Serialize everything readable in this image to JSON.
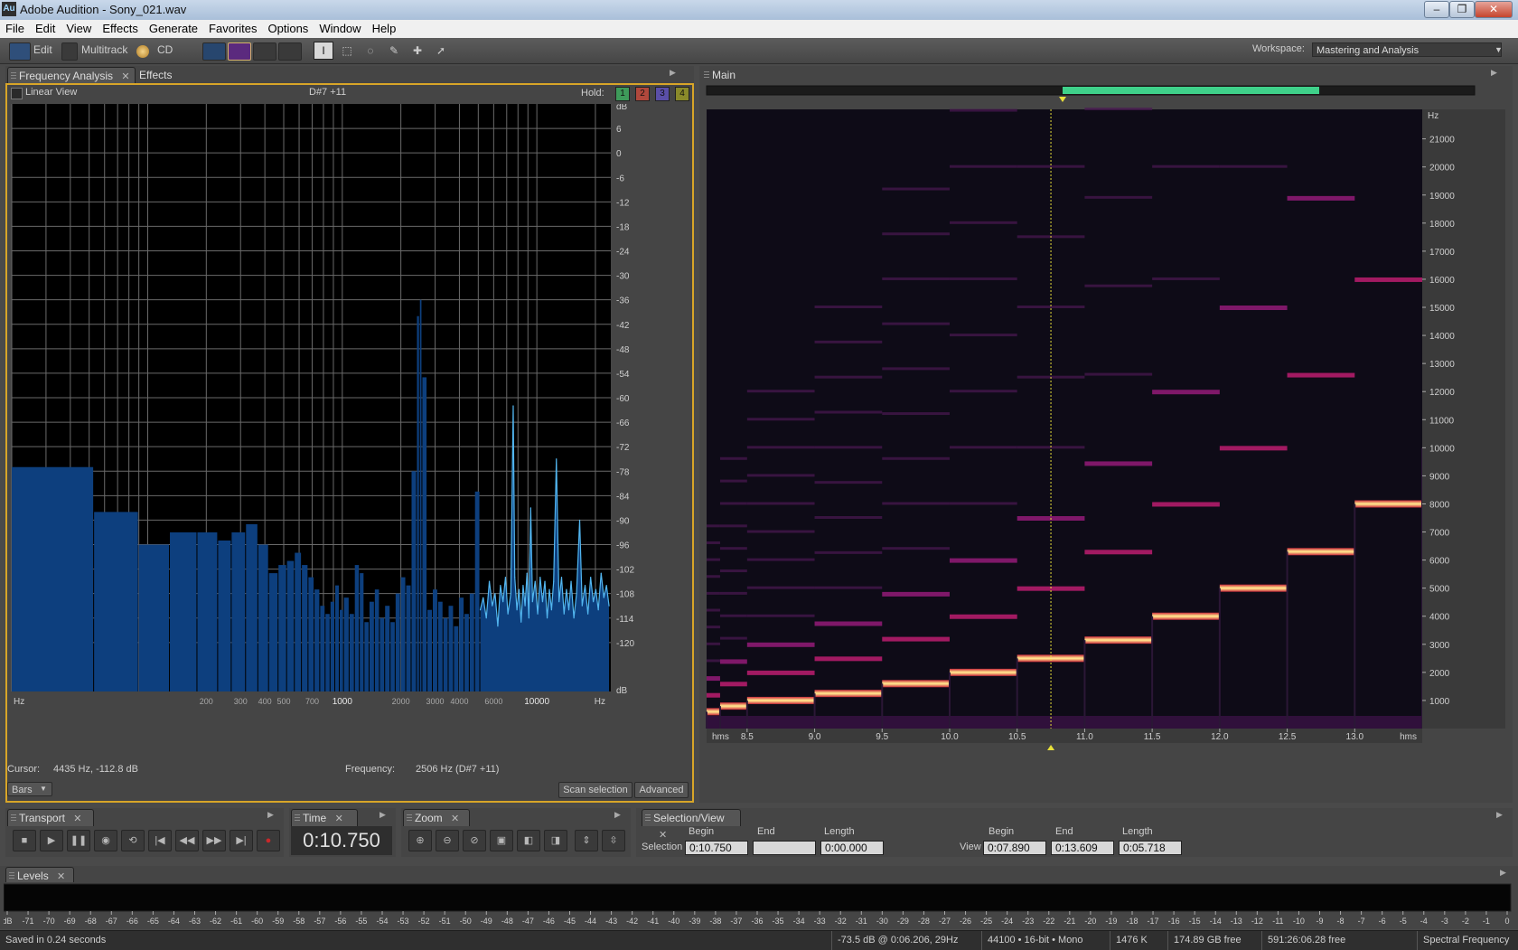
{
  "window": {
    "icon": "Au",
    "title": "Adobe Audition - Sony_021.wav",
    "minimize": "–",
    "restore": "❐",
    "close": "✕"
  },
  "menu": [
    "File",
    "Edit",
    "View",
    "Effects",
    "Generate",
    "Favorites",
    "Options",
    "Window",
    "Help"
  ],
  "toolbar": {
    "edit": "Edit",
    "multitrack": "Multitrack",
    "cd": "CD",
    "workspace_label": "Workspace:",
    "workspace_value": "Mastering and Analysis"
  },
  "freq_panel": {
    "tab_active": "Frequency Analysis",
    "tab_other": "Effects",
    "linear_view": "Linear View",
    "note": "D#7 +11",
    "hold_label": "Hold:",
    "holds": [
      "1",
      "2",
      "3",
      "4"
    ],
    "hold_colors": [
      "#3e9a5a",
      "#b0483c",
      "#5a4fa8",
      "#8a8a2a"
    ],
    "cursor_label": "Cursor:",
    "cursor_value": "4435 Hz, -112.8 dB",
    "frequency_label": "Frequency:",
    "frequency_value": "2506 Hz (D#7 +11)",
    "mode": "Bars",
    "scan_button": "Scan selection",
    "advanced_button": "Advanced"
  },
  "chart_data": [
    {
      "type": "bar",
      "title": "",
      "xlabel": "Hz",
      "ylabel": "dB",
      "x_scale": "log",
      "xlim": [
        20,
        24000
      ],
      "ylim": [
        -132,
        12
      ],
      "x_ticks": [
        {
          "value": 200,
          "label": "200"
        },
        {
          "value": 300,
          "label": "300"
        },
        {
          "value": 400,
          "label": "400"
        },
        {
          "value": 500,
          "label": "500"
        },
        {
          "value": 700,
          "label": "700"
        },
        {
          "value": 1000,
          "label": "1000"
        },
        {
          "value": 2000,
          "label": "2000"
        },
        {
          "value": 3000,
          "label": "3000"
        },
        {
          "value": 4000,
          "label": "4000"
        },
        {
          "value": 6000,
          "label": "6000"
        },
        {
          "value": 10000,
          "label": "10000"
        }
      ],
      "y_ticks": [
        "6",
        "0",
        "-6",
        "-12",
        "-18",
        "-24",
        "-30",
        "-36",
        "-42",
        "-48",
        "-54",
        "-60",
        "-66",
        "-72",
        "-78",
        "-84",
        "-90",
        "-96",
        "-102",
        "-108",
        "-114",
        "-120"
      ],
      "y_unit_top": "dB",
      "y_unit_bottom": "dB",
      "x_unit_left": "Hz",
      "x_unit_right": "Hz",
      "bars": [
        {
          "f0": 20,
          "f1": 53,
          "db": -77
        },
        {
          "f0": 53,
          "f1": 90,
          "db": -88
        },
        {
          "f0": 90,
          "f1": 130,
          "db": -96
        },
        {
          "f0": 130,
          "f1": 180,
          "db": -93
        },
        {
          "f0": 180,
          "f1": 230,
          "db": -93
        },
        {
          "f0": 230,
          "f1": 270,
          "db": -95
        },
        {
          "f0": 270,
          "f1": 320,
          "db": -93
        },
        {
          "f0": 320,
          "f1": 370,
          "db": -91
        },
        {
          "f0": 370,
          "f1": 420,
          "db": -96
        },
        {
          "f0": 420,
          "f1": 470,
          "db": -103
        },
        {
          "f0": 470,
          "f1": 520,
          "db": -101
        },
        {
          "f0": 520,
          "f1": 570,
          "db": -100
        },
        {
          "f0": 570,
          "f1": 620,
          "db": -98
        },
        {
          "f0": 620,
          "f1": 670,
          "db": -101
        },
        {
          "f0": 670,
          "f1": 720,
          "db": -104
        },
        {
          "f0": 720,
          "f1": 770,
          "db": -107
        },
        {
          "f0": 770,
          "f1": 820,
          "db": -111
        },
        {
          "f0": 820,
          "f1": 870,
          "db": -113
        },
        {
          "f0": 870,
          "f1": 920,
          "db": -110
        },
        {
          "f0": 920,
          "f1": 970,
          "db": -106
        },
        {
          "f0": 970,
          "f1": 1020,
          "db": -112
        },
        {
          "f0": 1020,
          "f1": 1090,
          "db": -109
        },
        {
          "f0": 1090,
          "f1": 1160,
          "db": -113
        },
        {
          "f0": 1160,
          "f1": 1230,
          "db": -101
        },
        {
          "f0": 1230,
          "f1": 1300,
          "db": -103
        },
        {
          "f0": 1300,
          "f1": 1380,
          "db": -115
        },
        {
          "f0": 1380,
          "f1": 1470,
          "db": -110
        },
        {
          "f0": 1470,
          "f1": 1560,
          "db": -107
        },
        {
          "f0": 1560,
          "f1": 1660,
          "db": -114
        },
        {
          "f0": 1660,
          "f1": 1770,
          "db": -111
        },
        {
          "f0": 1770,
          "f1": 1880,
          "db": -115
        },
        {
          "f0": 1880,
          "f1": 2000,
          "db": -108
        },
        {
          "f0": 2000,
          "f1": 2130,
          "db": -104
        },
        {
          "f0": 2130,
          "f1": 2270,
          "db": -106
        },
        {
          "f0": 2270,
          "f1": 2420,
          "db": -78
        },
        {
          "f0": 2420,
          "f1": 2506,
          "db": -40
        },
        {
          "f0": 2506,
          "f1": 2580,
          "db": -36
        },
        {
          "f0": 2580,
          "f1": 2740,
          "db": -55
        },
        {
          "f0": 2740,
          "f1": 2920,
          "db": -112
        },
        {
          "f0": 2920,
          "f1": 3110,
          "db": -107
        },
        {
          "f0": 3110,
          "f1": 3310,
          "db": -110
        },
        {
          "f0": 3310,
          "f1": 3520,
          "db": -114
        },
        {
          "f0": 3520,
          "f1": 3750,
          "db": -111
        },
        {
          "f0": 3750,
          "f1": 3990,
          "db": -116
        },
        {
          "f0": 3990,
          "f1": 4250,
          "db": -109
        },
        {
          "f0": 4250,
          "f1": 4520,
          "db": -113
        },
        {
          "f0": 4520,
          "f1": 4810,
          "db": -108
        },
        {
          "f0": 4810,
          "f1": 5120,
          "db": -83
        }
      ],
      "line_points": [
        {
          "f": 5120,
          "db": -112
        },
        {
          "f": 5300,
          "db": -109
        },
        {
          "f": 5500,
          "db": -114
        },
        {
          "f": 5700,
          "db": -105
        },
        {
          "f": 5900,
          "db": -111
        },
        {
          "f": 6100,
          "db": -108
        },
        {
          "f": 6300,
          "db": -116
        },
        {
          "f": 6500,
          "db": -106
        },
        {
          "f": 6700,
          "db": -110
        },
        {
          "f": 6900,
          "db": -104
        },
        {
          "f": 7100,
          "db": -113
        },
        {
          "f": 7350,
          "db": -108
        },
        {
          "f": 7560,
          "db": -62
        },
        {
          "f": 7700,
          "db": -104
        },
        {
          "f": 7900,
          "db": -112
        },
        {
          "f": 8100,
          "db": -107
        },
        {
          "f": 8300,
          "db": -115
        },
        {
          "f": 8500,
          "db": -106
        },
        {
          "f": 8700,
          "db": -111
        },
        {
          "f": 8900,
          "db": -103
        },
        {
          "f": 9100,
          "db": -114
        },
        {
          "f": 9300,
          "db": -87
        },
        {
          "f": 9500,
          "db": -110
        },
        {
          "f": 9800,
          "db": -105
        },
        {
          "f": 10100,
          "db": -113
        },
        {
          "f": 10400,
          "db": -104
        },
        {
          "f": 10700,
          "db": -110
        },
        {
          "f": 11000,
          "db": -105
        },
        {
          "f": 11300,
          "db": -114
        },
        {
          "f": 11600,
          "db": -107
        },
        {
          "f": 11900,
          "db": -112
        },
        {
          "f": 12200,
          "db": -105
        },
        {
          "f": 12600,
          "db": -75
        },
        {
          "f": 13000,
          "db": -110
        },
        {
          "f": 13400,
          "db": -104
        },
        {
          "f": 13800,
          "db": -113
        },
        {
          "f": 14200,
          "db": -107
        },
        {
          "f": 14600,
          "db": -112
        },
        {
          "f": 15000,
          "db": -105
        },
        {
          "f": 15500,
          "db": -114
        },
        {
          "f": 16000,
          "db": -108
        },
        {
          "f": 16600,
          "db": -90
        },
        {
          "f": 17100,
          "db": -111
        },
        {
          "f": 17700,
          "db": -106
        },
        {
          "f": 18300,
          "db": -113
        },
        {
          "f": 18900,
          "db": -104
        },
        {
          "f": 19500,
          "db": -110
        },
        {
          "f": 20100,
          "db": -107
        },
        {
          "f": 20700,
          "db": -112
        },
        {
          "f": 21400,
          "db": -103
        },
        {
          "f": 22100,
          "db": -109
        },
        {
          "f": 22800,
          "db": -106
        },
        {
          "f": 23500,
          "db": -111
        }
      ]
    },
    {
      "type": "heatmap",
      "title": "Main",
      "xlabel": "hms",
      "ylabel": "Hz",
      "xlim": [
        8.2,
        13.5
      ],
      "ylim": [
        0,
        22050
      ],
      "x_ticks": [
        "8.5",
        "9.0",
        "9.5",
        "10.0",
        "10.5",
        "11.0",
        "11.5",
        "12.0",
        "12.5",
        "13.0"
      ],
      "x_tick_values": [
        8.5,
        9.0,
        9.5,
        10.0,
        10.5,
        11.0,
        11.5,
        12.0,
        12.5,
        13.0
      ],
      "x_unit_left": "hms",
      "x_unit_right": "hms",
      "y_ticks": [
        "21000",
        "20000",
        "19000",
        "18000",
        "17000",
        "16000",
        "15000",
        "14000",
        "13000",
        "12000",
        "11000",
        "10000",
        "9000",
        "8000",
        "7000",
        "6000",
        "5000",
        "4000",
        "3000",
        "2000",
        "1000"
      ],
      "y_tick_values": [
        21000,
        20000,
        19000,
        18000,
        17000,
        16000,
        15000,
        14000,
        13000,
        12000,
        11000,
        10000,
        9000,
        8000,
        7000,
        6000,
        5000,
        4000,
        3000,
        2000,
        1000
      ],
      "y_unit_top": "Hz",
      "cursor_time": 10.75,
      "tones": [
        {
          "t0": 8.2,
          "t1": 8.3,
          "f": 600
        },
        {
          "t0": 8.3,
          "t1": 8.5,
          "f": 800
        },
        {
          "t0": 8.5,
          "t1": 9.0,
          "f": 1000
        },
        {
          "t0": 9.0,
          "t1": 9.5,
          "f": 1250
        },
        {
          "t0": 9.5,
          "t1": 10.0,
          "f": 1600
        },
        {
          "t0": 10.0,
          "t1": 10.5,
          "f": 2000
        },
        {
          "t0": 10.5,
          "t1": 11.0,
          "f": 2500
        },
        {
          "t0": 11.0,
          "t1": 11.5,
          "f": 3150
        },
        {
          "t0": 11.5,
          "t1": 12.0,
          "f": 4000
        },
        {
          "t0": 12.0,
          "t1": 12.5,
          "f": 5000
        },
        {
          "t0": 12.5,
          "t1": 13.0,
          "f": 6300
        },
        {
          "t0": 13.0,
          "t1": 13.5,
          "f": 8000
        },
        {
          "t0": 13.5,
          "t1": 13.6,
          "f": 10000
        }
      ]
    },
    {
      "type": "bar",
      "title": "Levels",
      "xlabel": "dB",
      "x_ticks": [
        "dB",
        "-71",
        "-70",
        "-69",
        "-68",
        "-67",
        "-66",
        "-65",
        "-64",
        "-63",
        "-62",
        "-61",
        "-60",
        "-59",
        "-58",
        "-57",
        "-56",
        "-55",
        "-54",
        "-53",
        "-52",
        "-51",
        "-50",
        "-49",
        "-48",
        "-47",
        "-46",
        "-45",
        "-44",
        "-43",
        "-42",
        "-41",
        "-40",
        "-39",
        "-38",
        "-37",
        "-36",
        "-35",
        "-34",
        "-33",
        "-32",
        "-31",
        "-30",
        "-29",
        "-28",
        "-27",
        "-26",
        "-25",
        "-24",
        "-23",
        "-22",
        "-21",
        "-20",
        "-19",
        "-18",
        "-17",
        "-16",
        "-15",
        "-14",
        "-13",
        "-12",
        "-11",
        "-10",
        "-9",
        "-8",
        "-7",
        "-6",
        "-5",
        "-4",
        "-3",
        "-2",
        "-1",
        "0"
      ]
    }
  ],
  "main_panel": {
    "tab": "Main"
  },
  "transport": {
    "tab": "Transport"
  },
  "time": {
    "tab": "Time",
    "value": "0:10.750"
  },
  "zoom": {
    "tab": "Zoom"
  },
  "selection_view": {
    "tab": "Selection/View",
    "begin": "Begin",
    "end": "End",
    "length": "Length",
    "selection_label": "Selection",
    "view_label": "View",
    "sel_begin": "0:10.750",
    "sel_end": "",
    "sel_length": "0:00.000",
    "view_begin": "0:07.890",
    "view_end": "0:13.609",
    "view_length": "0:05.718"
  },
  "levels": {
    "tab": "Levels"
  },
  "status": {
    "message": "Saved in 0.24 seconds",
    "cursor": "-73.5 dB @  0:06.206, 29Hz",
    "format": "44100 • 16-bit • Mono",
    "size": "1476 K",
    "disk": "174.89 GB free",
    "time_free": "591:26:06.28 free",
    "view_mode": "Spectral Frequency"
  }
}
